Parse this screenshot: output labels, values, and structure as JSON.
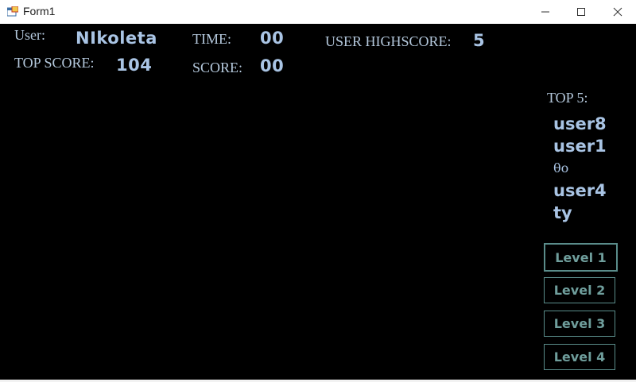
{
  "window": {
    "title": "Form1"
  },
  "header": {
    "user_label": "User:",
    "user_value": "NIkoleta",
    "top_score_label": "TOP SCORE:",
    "top_score_value": "104",
    "time_label": "TIME:",
    "time_value": "00",
    "score_label": "SCORE:",
    "score_value": "00",
    "user_highscore_label": "USER HIGHSCORE:",
    "user_highscore_value": "5"
  },
  "top5": {
    "label": "TOP 5:",
    "lines": [
      "user8",
      "user1",
      "θo",
      "user4",
      "ty"
    ]
  },
  "levels": [
    {
      "label": "Level 1"
    },
    {
      "label": "Level 2"
    },
    {
      "label": "Level 3"
    },
    {
      "label": "Level 4"
    }
  ],
  "colors": {
    "background": "#000000",
    "label": "#b4c8dc",
    "value": "#a9c4e4",
    "button_text": "#6f9e9c",
    "button_border": "#5a8c8a"
  },
  "icons": {
    "app": "form-icon",
    "minimize": "minimize-icon",
    "maximize": "maximize-icon",
    "close": "close-icon"
  }
}
